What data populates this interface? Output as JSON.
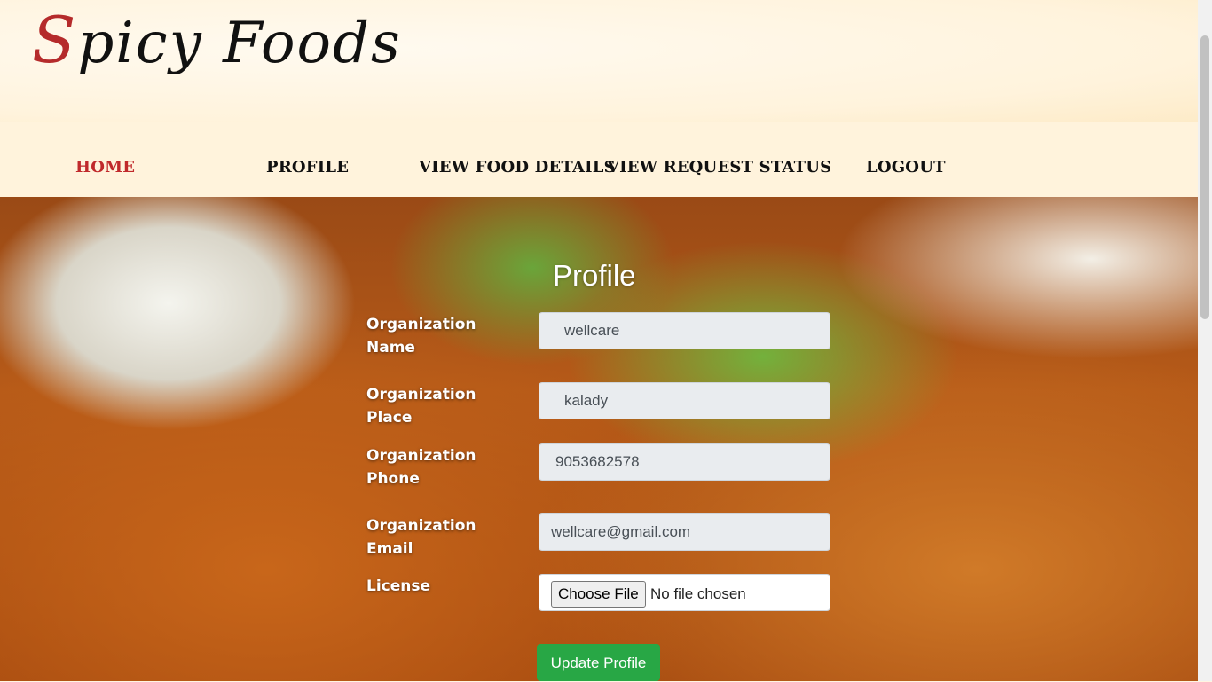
{
  "brand": {
    "first_letter": "S",
    "rest": "picy Foods"
  },
  "nav": {
    "items": [
      {
        "label": "HOME"
      },
      {
        "label": "PROFILE"
      },
      {
        "label": "VIEW FOOD DETAILS"
      },
      {
        "label": "VIEW REQUEST STATUS"
      },
      {
        "label": "LOGOUT"
      }
    ],
    "active_color": "#c0292b"
  },
  "form": {
    "title": "Profile",
    "fields": [
      {
        "label": "Organization Name",
        "value": "wellcare"
      },
      {
        "label": "Organization Place",
        "value": "kalady"
      },
      {
        "label": "Organization Phone",
        "value": "9053682578"
      },
      {
        "label": "Organization Email",
        "value": "wellcare@gmail.com"
      }
    ],
    "license": {
      "label": "License",
      "button": "Choose File",
      "status": "No file chosen"
    },
    "submit_label": "Update Profile",
    "submit_color": "#28a745"
  }
}
